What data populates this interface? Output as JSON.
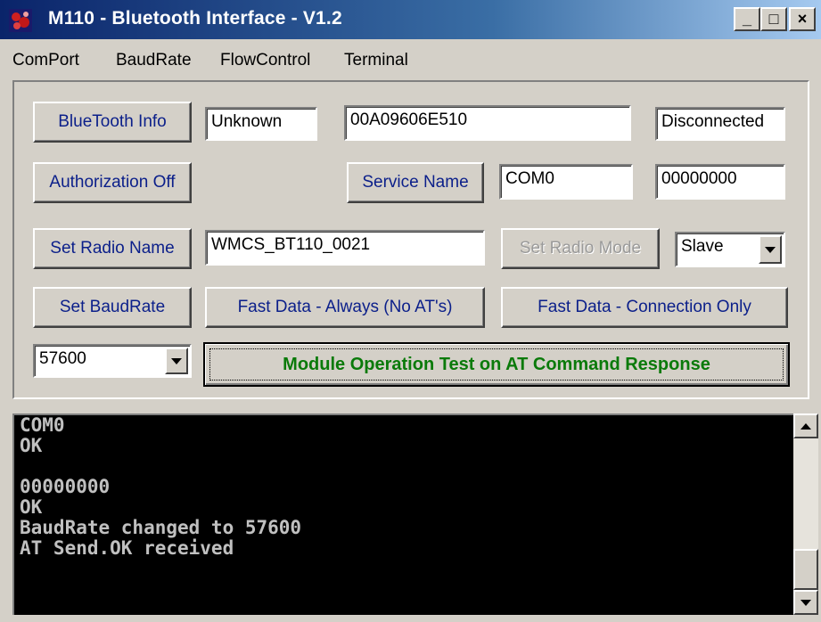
{
  "window": {
    "title": "M110 - Bluetooth Interface - V1.2",
    "icon": "bluetooth-app-icon",
    "controls": {
      "minimize": "_",
      "maximize": "□",
      "close": "×"
    }
  },
  "menu": [
    "ComPort",
    "BaudRate",
    "FlowControl",
    "Terminal"
  ],
  "panel": {
    "bluetooth_info_button": "BlueTooth Info",
    "device_type": "Unknown",
    "bd_address": "00A09606E510",
    "connection_status": "Disconnected",
    "authorization_button": "Authorization Off",
    "service_name_button": "Service Name",
    "service_name": "COM0",
    "service_code": "00000000",
    "set_radio_name_button": "Set Radio Name",
    "radio_name": "WMCS_BT110_0021",
    "set_radio_mode_button": "Set Radio Mode",
    "radio_mode": "Slave",
    "set_baudrate_button": "Set BaudRate",
    "fast_data_always_button": "Fast Data - Always (No AT's)",
    "fast_data_connection_button": "Fast Data - Connection Only",
    "baudrate": "57600",
    "module_test_button": "Module Operation Test on AT Command Response"
  },
  "terminal": {
    "lines": [
      "COM0",
      "OK",
      "",
      "00000000",
      "OK",
      "BaudRate changed to 57600",
      "AT Send.OK received"
    ],
    "scroll_position": 1.0
  },
  "colors": {
    "button_text": "#0b1f8a",
    "primary_button_text": "#0a7a0a",
    "titlebar_start": "#0a246a",
    "titlebar_end": "#a6caf0",
    "terminal_bg": "#000000",
    "terminal_text": "#c0c0c0"
  }
}
